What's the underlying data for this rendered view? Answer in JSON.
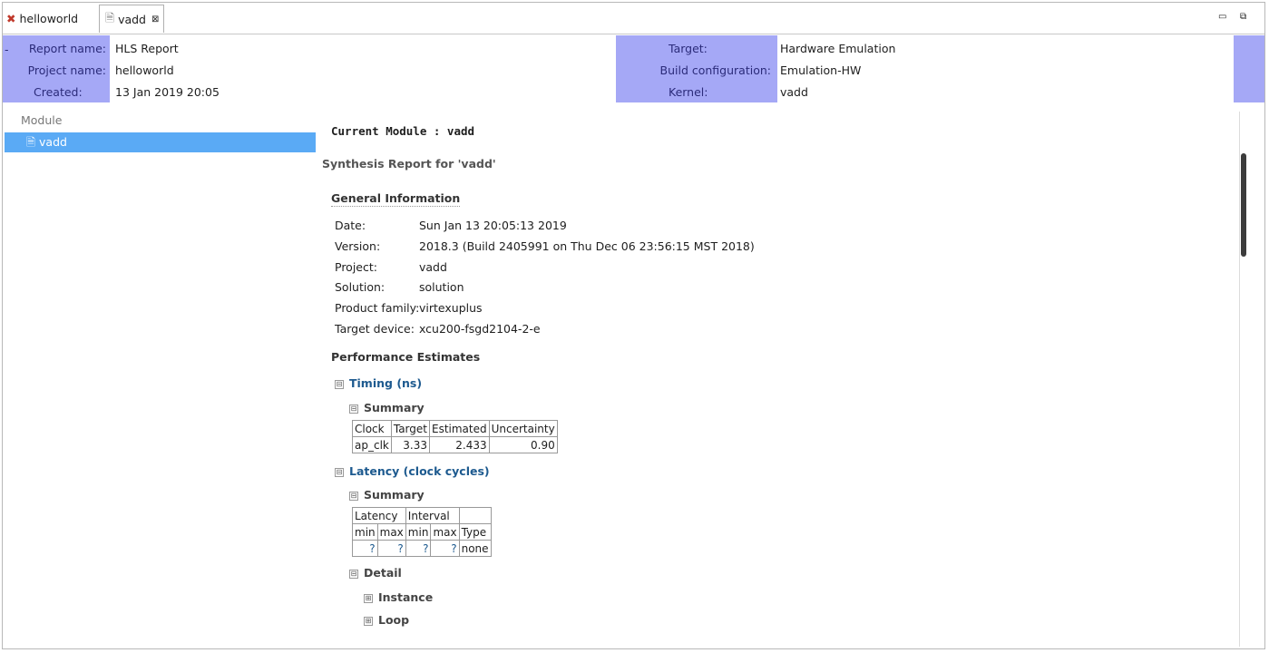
{
  "tabs": [
    {
      "label": "helloworld",
      "icon": "tools-icon"
    },
    {
      "label": "vadd",
      "icon": "document-icon",
      "close": "⊠"
    }
  ],
  "window_controls": {
    "minimize": "▭",
    "maximize": "⧉"
  },
  "header": {
    "report_name_label": "Report name:",
    "report_name": "HLS Report",
    "project_name_label": "Project name:",
    "project_name": "helloworld",
    "created_label": "Created:",
    "created": "13 Jan 2019 20:05",
    "target_label": "Target:",
    "target": "Hardware Emulation",
    "build_config_label": "Build configuration:",
    "build_config": "Emulation-HW",
    "kernel_label": "Kernel:",
    "kernel": "vadd",
    "collapse_glyph": "-"
  },
  "sidebar": {
    "heading": "Module",
    "items": [
      {
        "label": "vadd"
      }
    ]
  },
  "report": {
    "current_module": "Current Module : vadd",
    "title": "Synthesis Report for 'vadd'",
    "general_info_title": "General Information",
    "general_info": [
      {
        "key": "Date:",
        "value": "Sun Jan 13 20:05:13 2019"
      },
      {
        "key": "Version:",
        "value": "2018.3 (Build 2405991 on Thu Dec 06 23:56:15 MST 2018)"
      },
      {
        "key": "Project:",
        "value": "vadd"
      },
      {
        "key": "Solution:",
        "value": "solution"
      },
      {
        "key": "Product family:",
        "value": "virtexuplus"
      },
      {
        "key": "Target device:",
        "value": "xcu200-fsgd2104-2-e"
      }
    ],
    "perf_title": "Performance Estimates",
    "timing": {
      "label": "Timing (ns)",
      "summary_label": "Summary",
      "headers": [
        "Clock",
        "Target",
        "Estimated",
        "Uncertainty"
      ],
      "row": [
        "ap_clk",
        "3.33",
        "2.433",
        "0.90"
      ]
    },
    "latency": {
      "label": "Latency (clock cycles)",
      "summary_label": "Summary",
      "group_headers": [
        "Latency",
        "Interval",
        ""
      ],
      "sub_headers": [
        "min",
        "max",
        "min",
        "max",
        "Type"
      ],
      "row": [
        "?",
        "?",
        "?",
        "?",
        "none"
      ],
      "detail_label": "Detail",
      "instance_label": "Instance",
      "loop_label": "Loop"
    },
    "expand_glyph": "⊟",
    "collapsed_glyph": "⊞"
  }
}
